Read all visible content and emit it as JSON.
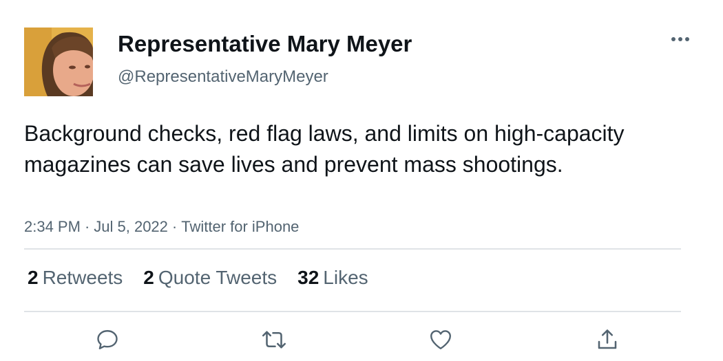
{
  "author": {
    "display_name": "Representative Mary Meyer",
    "handle": "@RepresentativeMaryMeyer",
    "avatar_icon": "profile-photo"
  },
  "tweet": {
    "text": "Background checks, red flag laws, and limits on high-capacity magazines can save lives and prevent mass shootings.",
    "time": "2:34 PM",
    "separator": "·",
    "date": "Jul 5, 2022",
    "source": "Twitter for iPhone"
  },
  "stats": {
    "retweets": {
      "count": "2",
      "label": "Retweets"
    },
    "quote_tweets": {
      "count": "2",
      "label": "Quote Tweets"
    },
    "likes": {
      "count": "32",
      "label": "Likes"
    }
  },
  "actions": {
    "reply_icon": "comment-bubble-icon",
    "retweet_icon": "retweet-arrows-icon",
    "like_icon": "heart-icon",
    "share_icon": "share-upload-icon"
  },
  "colors": {
    "text_primary": "#0f1419",
    "text_secondary": "#536471",
    "divider": "#dfe3e6",
    "background": "#ffffff"
  }
}
